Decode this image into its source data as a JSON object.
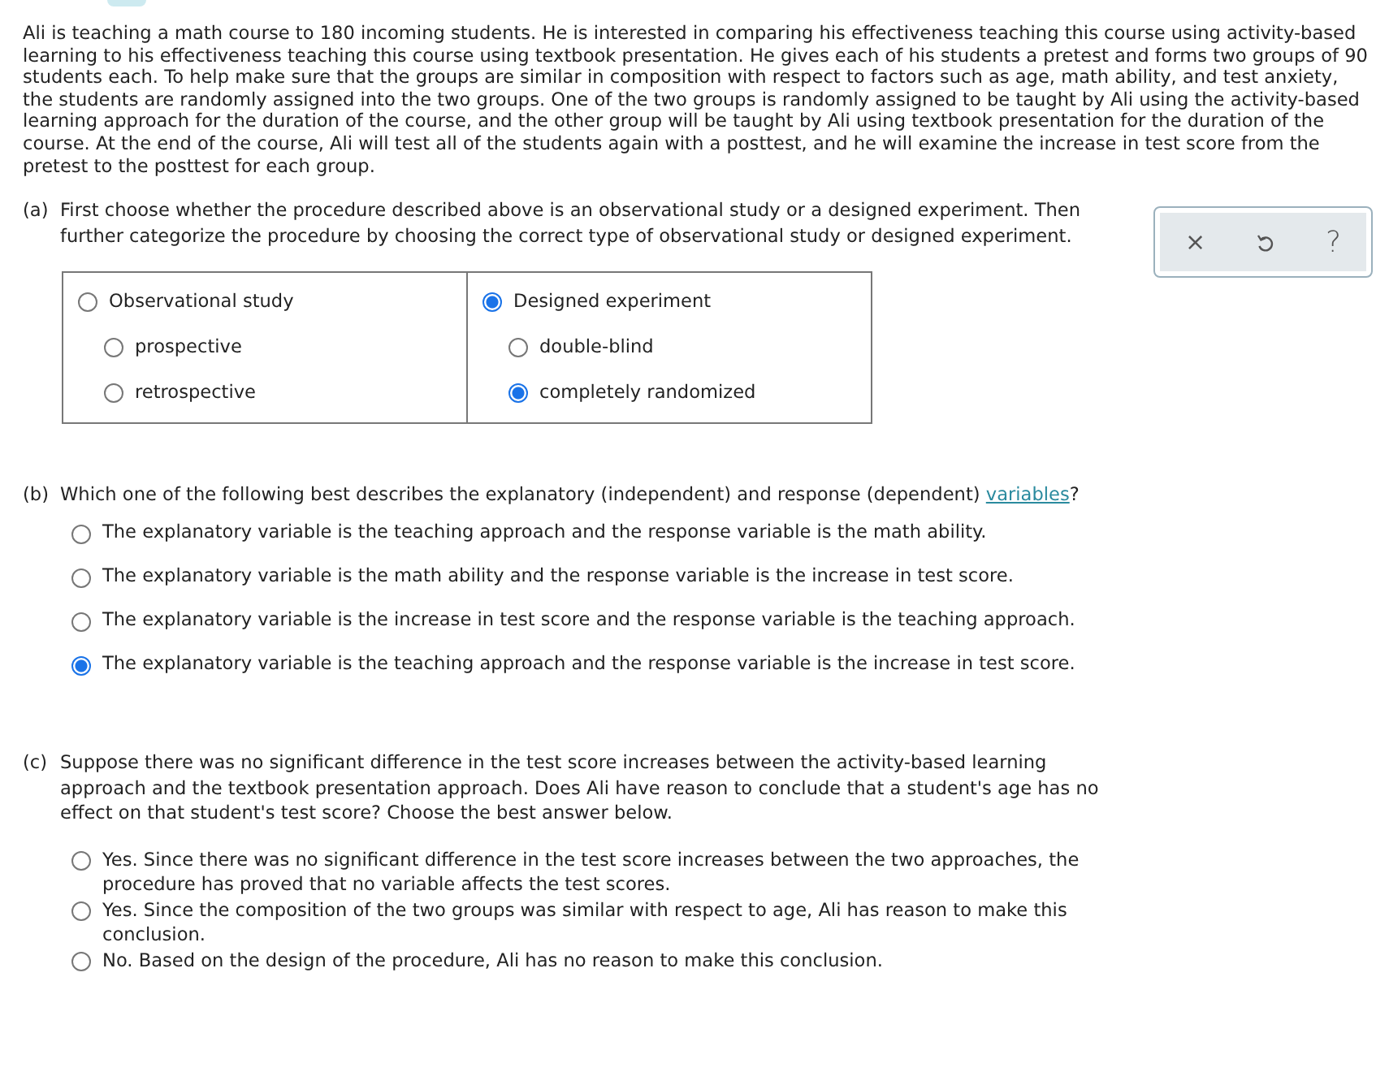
{
  "intro": "Ali is teaching a math course to 180 incoming students. He is interested in comparing his effectiveness teaching this course using activity-based learning to his effectiveness teaching this course using textbook presentation. He gives each of his students a pretest and forms two groups of 90 students each. To help make sure that the groups are similar in composition with respect to factors such as age, math ability, and test anxiety, the students are randomly assigned into the two groups. One of the two groups is randomly assigned to be taught by Ali using the activity-based learning approach for the duration of the course, and the other group will be taught by Ali using textbook presentation for the duration of the course. At the end of the course, Ali will test all of the students again with a posttest, and he will examine the increase in test score from the pretest to the posttest for each group.",
  "tools": {
    "clear": "×",
    "help": "?"
  },
  "part_a": {
    "label": "(a)",
    "prompt": "First choose whether the procedure described above is an observational study or a designed experiment. Then further categorize the procedure by choosing the correct type of observational study or designed experiment.",
    "columns": [
      {
        "option": {
          "label": "Observational study",
          "selected": false
        },
        "suboptions": [
          {
            "label": "prospective",
            "selected": false
          },
          {
            "label": "retrospective",
            "selected": false
          }
        ]
      },
      {
        "option": {
          "label": "Designed experiment",
          "selected": true
        },
        "suboptions": [
          {
            "label": "double-blind",
            "selected": false
          },
          {
            "label": "completely randomized",
            "selected": true
          }
        ]
      }
    ]
  },
  "part_b": {
    "label": "(b)",
    "prompt": "Which one of the following best describes the explanatory (independent) and response (dependent) ",
    "link": "variables",
    "prompt_end": "?",
    "options": [
      {
        "label": "The explanatory variable is the teaching approach and the response variable is the math ability.",
        "selected": false
      },
      {
        "label": "The explanatory variable is the math ability and the response variable is the increase in test score.",
        "selected": false
      },
      {
        "label": "The explanatory variable is the increase in test score and the response variable is the teaching approach.",
        "selected": false
      },
      {
        "label": "The explanatory variable is the teaching approach and the response variable is the increase in test score.",
        "selected": true
      }
    ]
  },
  "part_c": {
    "label": "(c)",
    "prompt": "Suppose there was no significant difference in the test score increases between the activity-based learning approach and the textbook presentation approach. Does Ali have reason to conclude that a student's age has no effect on that student's test score? Choose the best answer below.",
    "options": [
      {
        "label": "Yes. Since there was no significant difference in the test score increases between the two approaches, the procedure has proved that no variable affects the test scores.",
        "selected": false
      },
      {
        "label": "Yes. Since the composition of the two groups was similar with respect to age, Ali has reason to make this conclusion.",
        "selected": false
      },
      {
        "label": "No. Based on the design of the procedure, Ali has no reason to make this conclusion.",
        "selected": false
      }
    ]
  }
}
